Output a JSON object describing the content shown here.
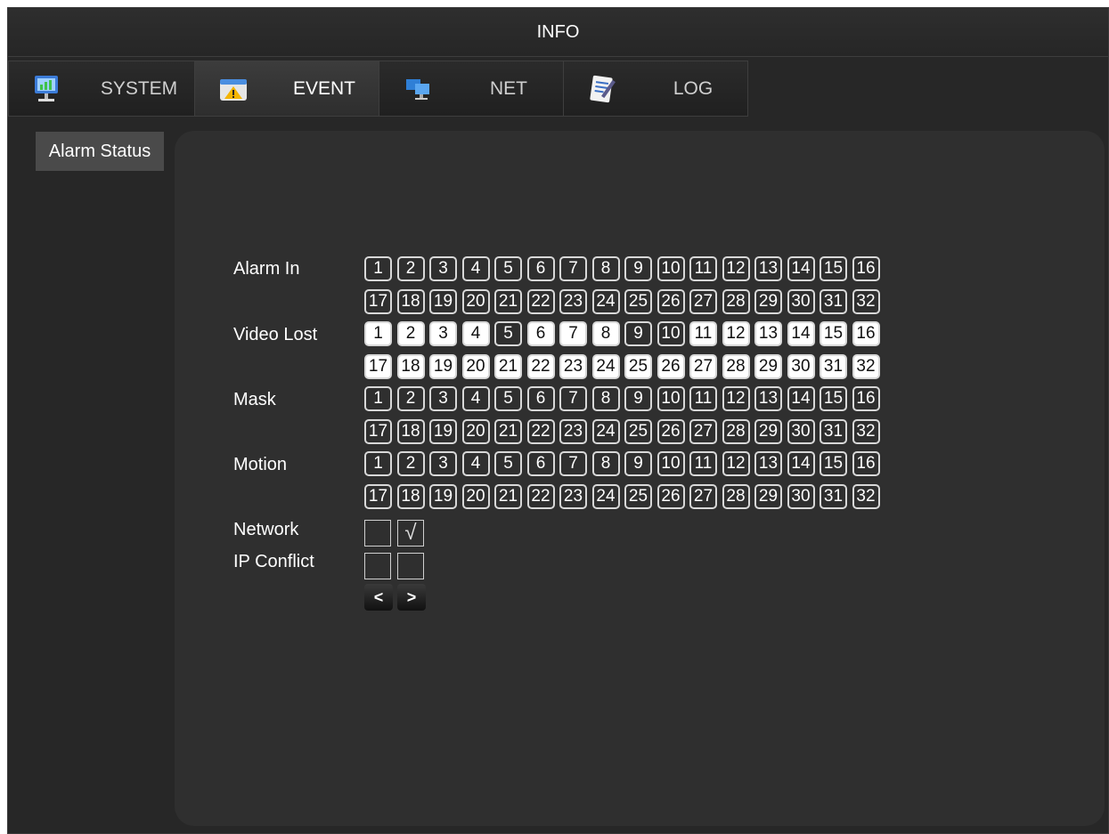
{
  "window": {
    "title": "INFO"
  },
  "tabs": [
    {
      "label": "SYSTEM",
      "icon": "monitor-chart-icon",
      "active": false
    },
    {
      "label": "EVENT",
      "icon": "warning-window-icon",
      "active": true
    },
    {
      "label": "NET",
      "icon": "network-computers-icon",
      "active": false
    },
    {
      "label": "LOG",
      "icon": "log-notepad-icon",
      "active": false
    }
  ],
  "sidebar": {
    "items": [
      {
        "label": "Alarm Status",
        "active": true
      }
    ]
  },
  "alarm_status": {
    "rows": [
      {
        "label": "Alarm In",
        "channels_row1": [
          "1",
          "2",
          "3",
          "4",
          "5",
          "6",
          "7",
          "8",
          "9",
          "10",
          "11",
          "12",
          "13",
          "14",
          "15",
          "16"
        ],
        "channels_row2": [
          "17",
          "18",
          "19",
          "20",
          "21",
          "22",
          "23",
          "24",
          "25",
          "26",
          "27",
          "28",
          "29",
          "30",
          "31",
          "32"
        ],
        "active_row1": [],
        "active_row2": []
      },
      {
        "label": "Video Lost",
        "channels_row1": [
          "1",
          "2",
          "3",
          "4",
          "5",
          "6",
          "7",
          "8",
          "9",
          "10",
          "11",
          "12",
          "13",
          "14",
          "15",
          "16"
        ],
        "channels_row2": [
          "17",
          "18",
          "19",
          "20",
          "21",
          "22",
          "23",
          "24",
          "25",
          "26",
          "27",
          "28",
          "29",
          "30",
          "31",
          "32"
        ],
        "active_row1": [
          1,
          2,
          3,
          4,
          6,
          7,
          8,
          11,
          12,
          13,
          14,
          15,
          16
        ],
        "active_row2": [
          17,
          18,
          19,
          20,
          21,
          22,
          23,
          24,
          25,
          26,
          27,
          28,
          29,
          30,
          31,
          32
        ]
      },
      {
        "label": "Mask",
        "channels_row1": [
          "1",
          "2",
          "3",
          "4",
          "5",
          "6",
          "7",
          "8",
          "9",
          "10",
          "11",
          "12",
          "13",
          "14",
          "15",
          "16"
        ],
        "channels_row2": [
          "17",
          "18",
          "19",
          "20",
          "21",
          "22",
          "23",
          "24",
          "25",
          "26",
          "27",
          "28",
          "29",
          "30",
          "31",
          "32"
        ],
        "active_row1": [],
        "active_row2": []
      },
      {
        "label": "Motion",
        "channels_row1": [
          "1",
          "2",
          "3",
          "4",
          "5",
          "6",
          "7",
          "8",
          "9",
          "10",
          "11",
          "12",
          "13",
          "14",
          "15",
          "16"
        ],
        "channels_row2": [
          "17",
          "18",
          "19",
          "20",
          "21",
          "22",
          "23",
          "24",
          "25",
          "26",
          "27",
          "28",
          "29",
          "30",
          "31",
          "32"
        ],
        "active_row1": [],
        "active_row2": []
      }
    ],
    "network": {
      "label": "Network",
      "boxes": [
        "",
        "√"
      ]
    },
    "ip_conflict": {
      "label": "IP Conflict",
      "boxes": [
        "",
        ""
      ]
    },
    "nav": {
      "prev": "<",
      "next": ">"
    }
  }
}
